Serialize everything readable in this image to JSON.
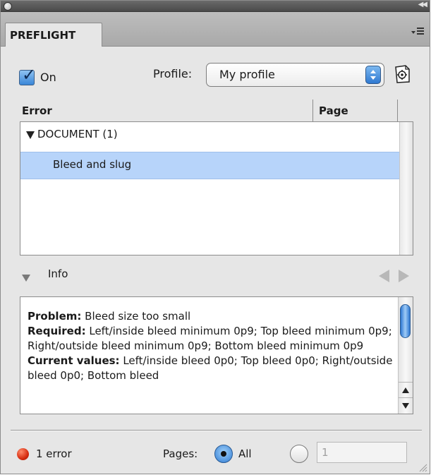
{
  "panel": {
    "tab_label": "PREFLIGHT"
  },
  "controls": {
    "on_label": "On",
    "on_checked": true,
    "profile_label": "Profile:",
    "profile_value": "My profile"
  },
  "errors_table": {
    "columns": [
      "Error",
      "Page"
    ],
    "group_label": "DOCUMENT (1)",
    "rows": [
      {
        "label": "Bleed and slug",
        "page": ""
      }
    ]
  },
  "info": {
    "label": "Info",
    "problem_label": "Problem:",
    "problem_text": " Bleed size too small",
    "required_label": "Required:",
    "required_text": " Left/inside bleed minimum 0p9; Top bleed minimum 0p9; Right/outside bleed minimum 0p9; Bottom bleed minimum 0p9",
    "current_label": "Current values:",
    "current_text": " Left/inside bleed 0p0; Top bleed 0p0; Right/outside bleed 0p0; Bottom bleed"
  },
  "footer": {
    "error_count": "1 error",
    "error_color": "#d62d10",
    "pages_label": "Pages:",
    "all_label": "All",
    "all_selected": true,
    "page_range_value": "1"
  },
  "icons": {
    "close": "close-icon",
    "collapse": "double-chevron-icon",
    "panel_menu": "panel-menu-icon",
    "define_profiles": "define-profiles-icon",
    "disclosure": "disclosure-triangle-icon",
    "status": "red-dot-icon"
  },
  "colors": {
    "selection": "#b7d4fa",
    "accent_blue": "#2f7cd4",
    "panel_bg": "#e6e6e6"
  }
}
